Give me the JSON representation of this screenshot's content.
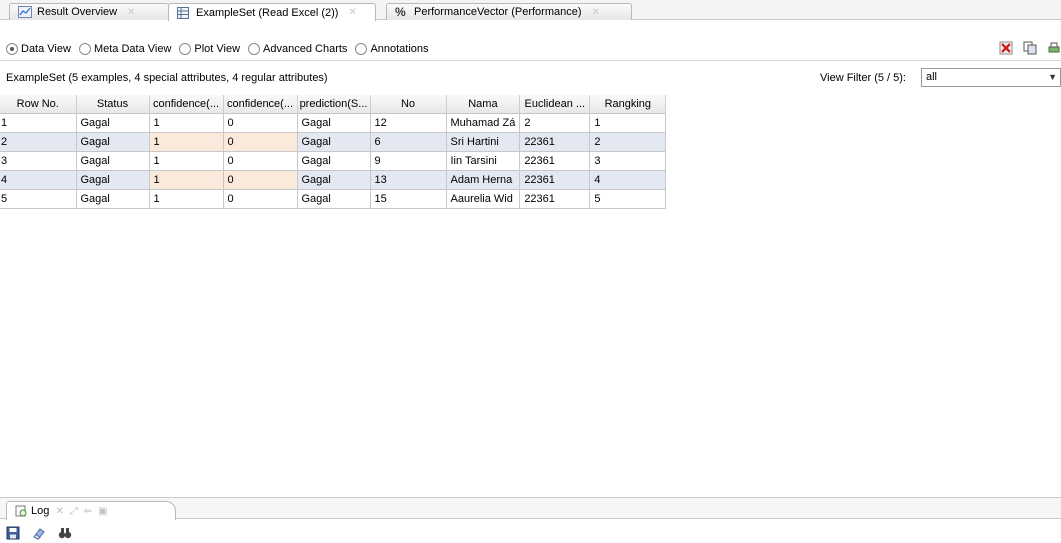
{
  "tabs": [
    {
      "label": "Result Overview",
      "icon": "chart-icon"
    },
    {
      "label": "ExampleSet (Read Excel (2))",
      "icon": "table-icon"
    },
    {
      "label": "PerformanceVector (Performance)",
      "icon": "percent-icon"
    }
  ],
  "views": [
    {
      "label": "Data View",
      "checked": true
    },
    {
      "label": "Meta Data View",
      "checked": false
    },
    {
      "label": "Plot View",
      "checked": false
    },
    {
      "label": "Advanced Charts",
      "checked": false
    },
    {
      "label": "Annotations",
      "checked": false
    }
  ],
  "info": {
    "summary": "ExampleSet (5 examples, 4 special attributes, 4 regular attributes)",
    "filter_label": "View Filter (5 / 5):",
    "filter_value": "all"
  },
  "table": {
    "columns": [
      "Row No.",
      "Status",
      "confidence(...",
      "confidence(...",
      "prediction(S...",
      "No",
      "Nama",
      "Euclidean ...",
      "Rangking"
    ],
    "rows": [
      [
        "1",
        "Gagal",
        "1",
        "0",
        "Gagal",
        "12",
        "Muhamad Zá",
        "2",
        "1"
      ],
      [
        "2",
        "Gagal",
        "1",
        "0",
        "Gagal",
        "6",
        "Sri Hartini",
        "22361",
        "2"
      ],
      [
        "3",
        "Gagal",
        "1",
        "0",
        "Gagal",
        "9",
        "Iin Tarsini",
        "22361",
        "3"
      ],
      [
        "4",
        "Gagal",
        "1",
        "0",
        "Gagal",
        "13",
        "Adam Herna",
        "22361",
        "4"
      ],
      [
        "5",
        "Gagal",
        "1",
        "0",
        "Gagal",
        "15",
        "Aaurelia Wid",
        "22361",
        "5"
      ]
    ]
  },
  "log_tab": {
    "label": "Log"
  },
  "colors": {
    "row_alt": "#e4e8f2",
    "row_alt_mid": "#faeadb",
    "close_red": "#cc1f1f"
  }
}
